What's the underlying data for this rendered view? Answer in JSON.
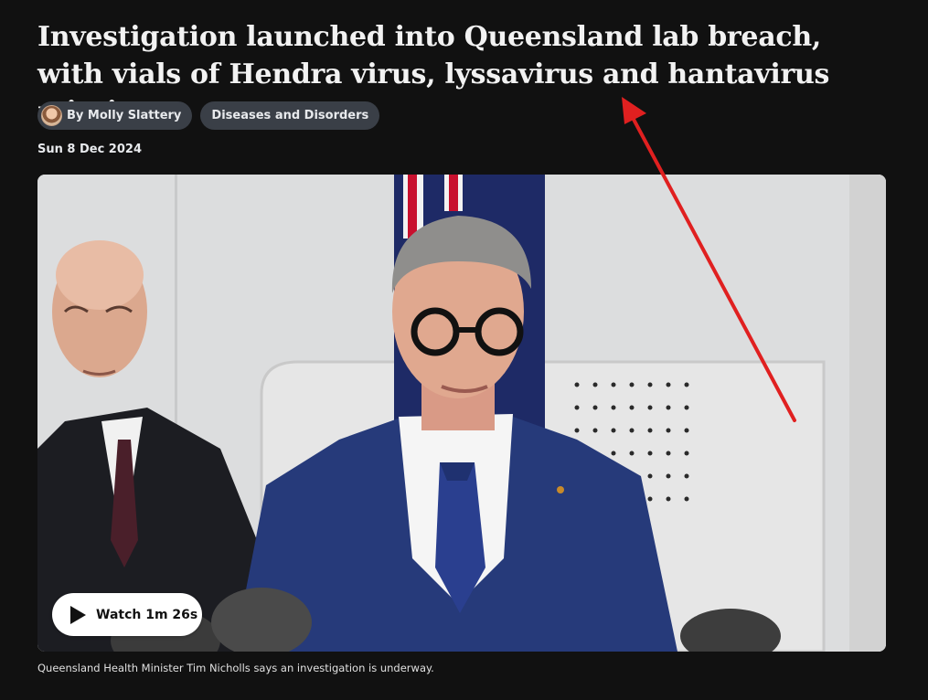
{
  "article": {
    "headline": "Investigation launched into Queensland lab breach, with vials of Hendra virus, lyssavirus and hantavirus missing",
    "author_label": "By Molly Slattery",
    "topic_label": "Diseases and Disorders",
    "date": "Sun 8 Dec 2024"
  },
  "video": {
    "watch_label": "Watch 1m 26s",
    "caption": "Queensland Health Minister Tim Nicholls says an investigation is underway."
  },
  "icons": {
    "play": "play-icon",
    "avatar": "author-avatar"
  },
  "colors": {
    "background": "#111111",
    "pill_background": "#3a3f47",
    "annotation_arrow": "#e02020"
  }
}
